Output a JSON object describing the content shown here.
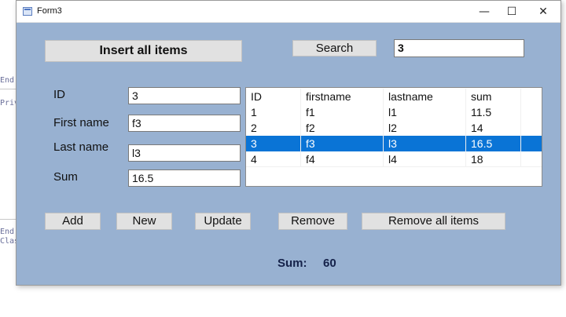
{
  "background": {
    "code_snippets": [
      "End",
      "Priv",
      "End",
      "Clas"
    ]
  },
  "window": {
    "title": "Form3",
    "controls": {
      "minimize": "—",
      "maximize": "☐",
      "close": "✕"
    }
  },
  "toolbar": {
    "insert_all_label": "Insert all items",
    "search_label": "Search",
    "search_value": "3"
  },
  "form": {
    "id_label": "ID",
    "id_value": "3",
    "firstname_label": "First name",
    "firstname_value": "f3",
    "lastname_label": "Last name",
    "lastname_value": "l3",
    "sum_label": "Sum",
    "sum_value": "16.5"
  },
  "grid": {
    "columns": [
      "ID",
      "firstname",
      "lastname",
      "sum"
    ],
    "rows": [
      [
        "1",
        "f1",
        "l1",
        "11.5"
      ],
      [
        "2",
        "f2",
        "l2",
        "14"
      ],
      [
        "3",
        "f3",
        "l3",
        "16.5"
      ],
      [
        "4",
        "f4",
        "l4",
        "18"
      ]
    ],
    "selected_row": 2
  },
  "actions": {
    "add": "Add",
    "new": "New",
    "update": "Update",
    "remove": "Remove",
    "remove_all": "Remove all items"
  },
  "total": {
    "label": "Sum:",
    "value": "60"
  },
  "colors": {
    "form_background": "#98b1d1",
    "selection": "#0a74d6",
    "sum_text": "#15224a"
  }
}
